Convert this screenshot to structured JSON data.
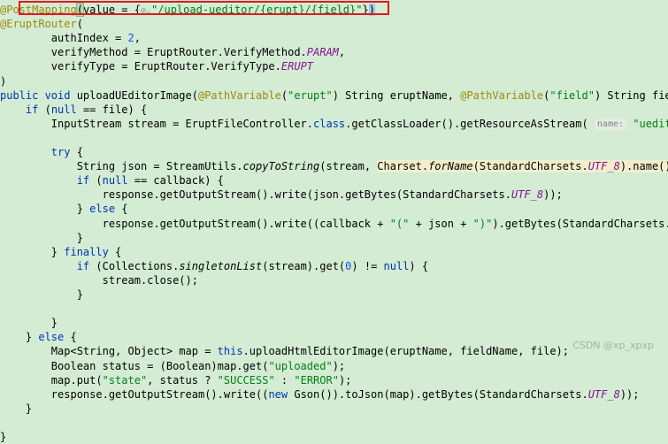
{
  "lines": [
    {
      "t": "line-1",
      "segs": [
        [
          "ann",
          "@PostMapping"
        ],
        [
          "paren-hl",
          "("
        ],
        [
          "",
          "value = {"
        ],
        [
          "ghost-icon",
          "⊘⌄"
        ],
        [
          "str",
          "\""
        ],
        [
          "str-u",
          "/upload-ueditor/{erupt}/{field}"
        ],
        [
          "str",
          "\""
        ],
        [
          "",
          "}"
        ],
        [
          "brace-hl",
          ")"
        ]
      ]
    },
    {
      "t": "line-2",
      "segs": [
        [
          "ann",
          "@EruptRouter"
        ],
        [
          "",
          "("
        ]
      ]
    },
    {
      "t": "line-3",
      "segs": [
        [
          "",
          "        authIndex = "
        ],
        [
          "num",
          "2"
        ],
        [
          "",
          ","
        ]
      ]
    },
    {
      "t": "line-4",
      "segs": [
        [
          "",
          "        verifyMethod = EruptRouter.VerifyMethod."
        ],
        [
          "const",
          "PARAM"
        ],
        [
          "",
          ","
        ]
      ]
    },
    {
      "t": "line-5",
      "segs": [
        [
          "",
          "        verifyType = EruptRouter.VerifyType."
        ],
        [
          "const",
          "ERUPT"
        ]
      ]
    },
    {
      "t": "line-6",
      "segs": [
        [
          "",
          ")"
        ]
      ]
    },
    {
      "t": "line-7",
      "segs": [
        [
          "kw",
          "public void "
        ],
        [
          "",
          "uploadUEditorImage("
        ],
        [
          "ann",
          "@PathVariable"
        ],
        [
          "",
          "("
        ],
        [
          "str",
          "\"erupt\""
        ],
        [
          "",
          ") String eruptName, "
        ],
        [
          "ann",
          "@PathVariable"
        ],
        [
          "",
          "("
        ],
        [
          "str",
          "\"field\""
        ],
        [
          "",
          ") String fie"
        ]
      ]
    },
    {
      "t": "line-8",
      "segs": [
        [
          "",
          "    "
        ],
        [
          "kw",
          "if "
        ],
        [
          "",
          "("
        ],
        [
          "kw",
          "null"
        ],
        [
          "",
          " == file) {"
        ]
      ]
    },
    {
      "t": "line-9",
      "segs": [
        [
          "",
          "        InputStream stream = EruptFileController."
        ],
        [
          "kw",
          "class"
        ],
        [
          "",
          ".getClassLoader().getResourceAsStream( "
        ],
        [
          "hint",
          "name:"
        ],
        [
          "",
          " "
        ],
        [
          "str",
          "\"uedit"
        ]
      ]
    },
    {
      "t": "line-10",
      "segs": [
        [
          "",
          ""
        ]
      ]
    },
    {
      "t": "line-11",
      "segs": [
        [
          "",
          "        "
        ],
        [
          "kw",
          "try "
        ],
        [
          "",
          "{"
        ]
      ]
    },
    {
      "t": "line-12",
      "segs": [
        [
          "",
          "            String json = StreamUtils."
        ],
        [
          "it",
          "copyToString"
        ],
        [
          "",
          "(stream, "
        ],
        [
          "sel-hl",
          "Charset."
        ],
        [
          "sel-hl it",
          "forName"
        ],
        [
          "sel-hl",
          "(StandardCharsets."
        ],
        [
          "sel-hl const",
          "UTF_8"
        ],
        [
          "sel-hl",
          ").name()"
        ],
        [
          "",
          ")"
        ]
      ]
    },
    {
      "t": "line-13",
      "segs": [
        [
          "",
          "            "
        ],
        [
          "kw",
          "if "
        ],
        [
          "",
          "("
        ],
        [
          "kw",
          "null"
        ],
        [
          "",
          " == callback) {"
        ]
      ]
    },
    {
      "t": "line-14",
      "segs": [
        [
          "",
          "                response.getOutputStream().write(json.getBytes(StandardCharsets."
        ],
        [
          "const",
          "UTF_8"
        ],
        [
          "",
          "));"
        ]
      ]
    },
    {
      "t": "line-15",
      "segs": [
        [
          "",
          "            } "
        ],
        [
          "kw",
          "else "
        ],
        [
          "",
          "{"
        ]
      ]
    },
    {
      "t": "line-16",
      "segs": [
        [
          "",
          "                response.getOutputStream().write((callback + "
        ],
        [
          "str",
          "\"(\""
        ],
        [
          "",
          " + json + "
        ],
        [
          "str",
          "\")\""
        ],
        [
          "",
          ").getBytes(StandardCharsets."
        ]
      ]
    },
    {
      "t": "line-17",
      "segs": [
        [
          "",
          "            }"
        ]
      ]
    },
    {
      "t": "line-18",
      "segs": [
        [
          "",
          "        } "
        ],
        [
          "kw",
          "finally "
        ],
        [
          "",
          "{"
        ]
      ]
    },
    {
      "t": "line-19",
      "segs": [
        [
          "",
          "            "
        ],
        [
          "kw",
          "if "
        ],
        [
          "",
          "(Collections."
        ],
        [
          "it",
          "singletonList"
        ],
        [
          "",
          "(stream).get("
        ],
        [
          "num",
          "0"
        ],
        [
          "",
          ") != "
        ],
        [
          "kw",
          "null"
        ],
        [
          "",
          ") {"
        ]
      ]
    },
    {
      "t": "line-20",
      "segs": [
        [
          "",
          "                stream.close();"
        ]
      ]
    },
    {
      "t": "line-21",
      "segs": [
        [
          "",
          "            }"
        ]
      ]
    },
    {
      "t": "line-22",
      "segs": [
        [
          "",
          ""
        ]
      ]
    },
    {
      "t": "line-23",
      "segs": [
        [
          "",
          "        }"
        ]
      ]
    },
    {
      "t": "line-24",
      "segs": [
        [
          "",
          "    } "
        ],
        [
          "kw",
          "else "
        ],
        [
          "",
          "{"
        ]
      ]
    },
    {
      "t": "line-25",
      "segs": [
        [
          "",
          "        Map<String, Object> map = "
        ],
        [
          "kw",
          "this"
        ],
        [
          "",
          ".uploadHtmlEditorImage(eruptName, fieldName, file);"
        ]
      ]
    },
    {
      "t": "line-26",
      "segs": [
        [
          "",
          "        Boolean status = (Boolean)map.get("
        ],
        [
          "str",
          "\"uploaded\""
        ],
        [
          "",
          ");"
        ]
      ]
    },
    {
      "t": "line-27",
      "segs": [
        [
          "",
          "        map.put("
        ],
        [
          "str",
          "\"state\""
        ],
        [
          "",
          ", status ? "
        ],
        [
          "str",
          "\"SUCCESS\""
        ],
        [
          "",
          " : "
        ],
        [
          "str",
          "\"ERROR\""
        ],
        [
          "",
          ");"
        ]
      ]
    },
    {
      "t": "line-28",
      "segs": [
        [
          "",
          "        response.getOutputStream().write(("
        ],
        [
          "kw",
          "new "
        ],
        [
          "",
          "Gson()).toJson(map).getBytes(StandardCharsets."
        ],
        [
          "const",
          "UTF_8"
        ],
        [
          "",
          "));"
        ]
      ]
    },
    {
      "t": "line-29",
      "segs": [
        [
          "",
          "    }"
        ]
      ]
    },
    {
      "t": "line-30",
      "segs": [
        [
          "",
          ""
        ]
      ]
    },
    {
      "t": "line-31",
      "segs": [
        [
          "",
          "}"
        ]
      ]
    }
  ],
  "watermark": "CSDN @xp_xpxp",
  "colors": {
    "background": "#d3ecd3",
    "highlight_box": "#e0191e"
  }
}
